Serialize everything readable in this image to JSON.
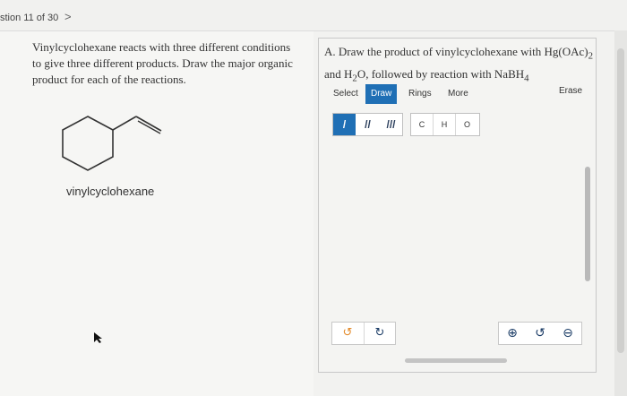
{
  "header": {
    "question_counter": "stion 11 of 30",
    "next_glyph": ">"
  },
  "question": {
    "text": "Vinylcyclohexane reacts with three different conditions to give three different products. Draw the major organic product for each of the reactions.",
    "molecule_label": "vinylcyclohexane"
  },
  "part_a": {
    "prefix": "A. Draw the product of vinylcyclohexane with Hg(OAc)",
    "sub1": "2",
    "line2_a": "and H",
    "sub2": "2",
    "line2_b": "O, followed by reaction with NaBH",
    "sub3": "4"
  },
  "toolbar": {
    "tabs": [
      "Select",
      "Draw",
      "Rings",
      "More"
    ],
    "active_tab": "Draw",
    "erase_label": "Erase",
    "bonds": [
      "/",
      "//",
      "///"
    ],
    "atoms": [
      "C",
      "H",
      "O"
    ]
  },
  "controls": {
    "undo_icon": "↺",
    "redo_icon": "↻",
    "zoom_in_icon": "⊕",
    "reset_icon": "↺",
    "zoom_out_icon": "⊖"
  },
  "colors": {
    "accent": "#1f6fb5",
    "undo_orange": "#e38b2c",
    "icon_blue": "#1b3c66"
  }
}
